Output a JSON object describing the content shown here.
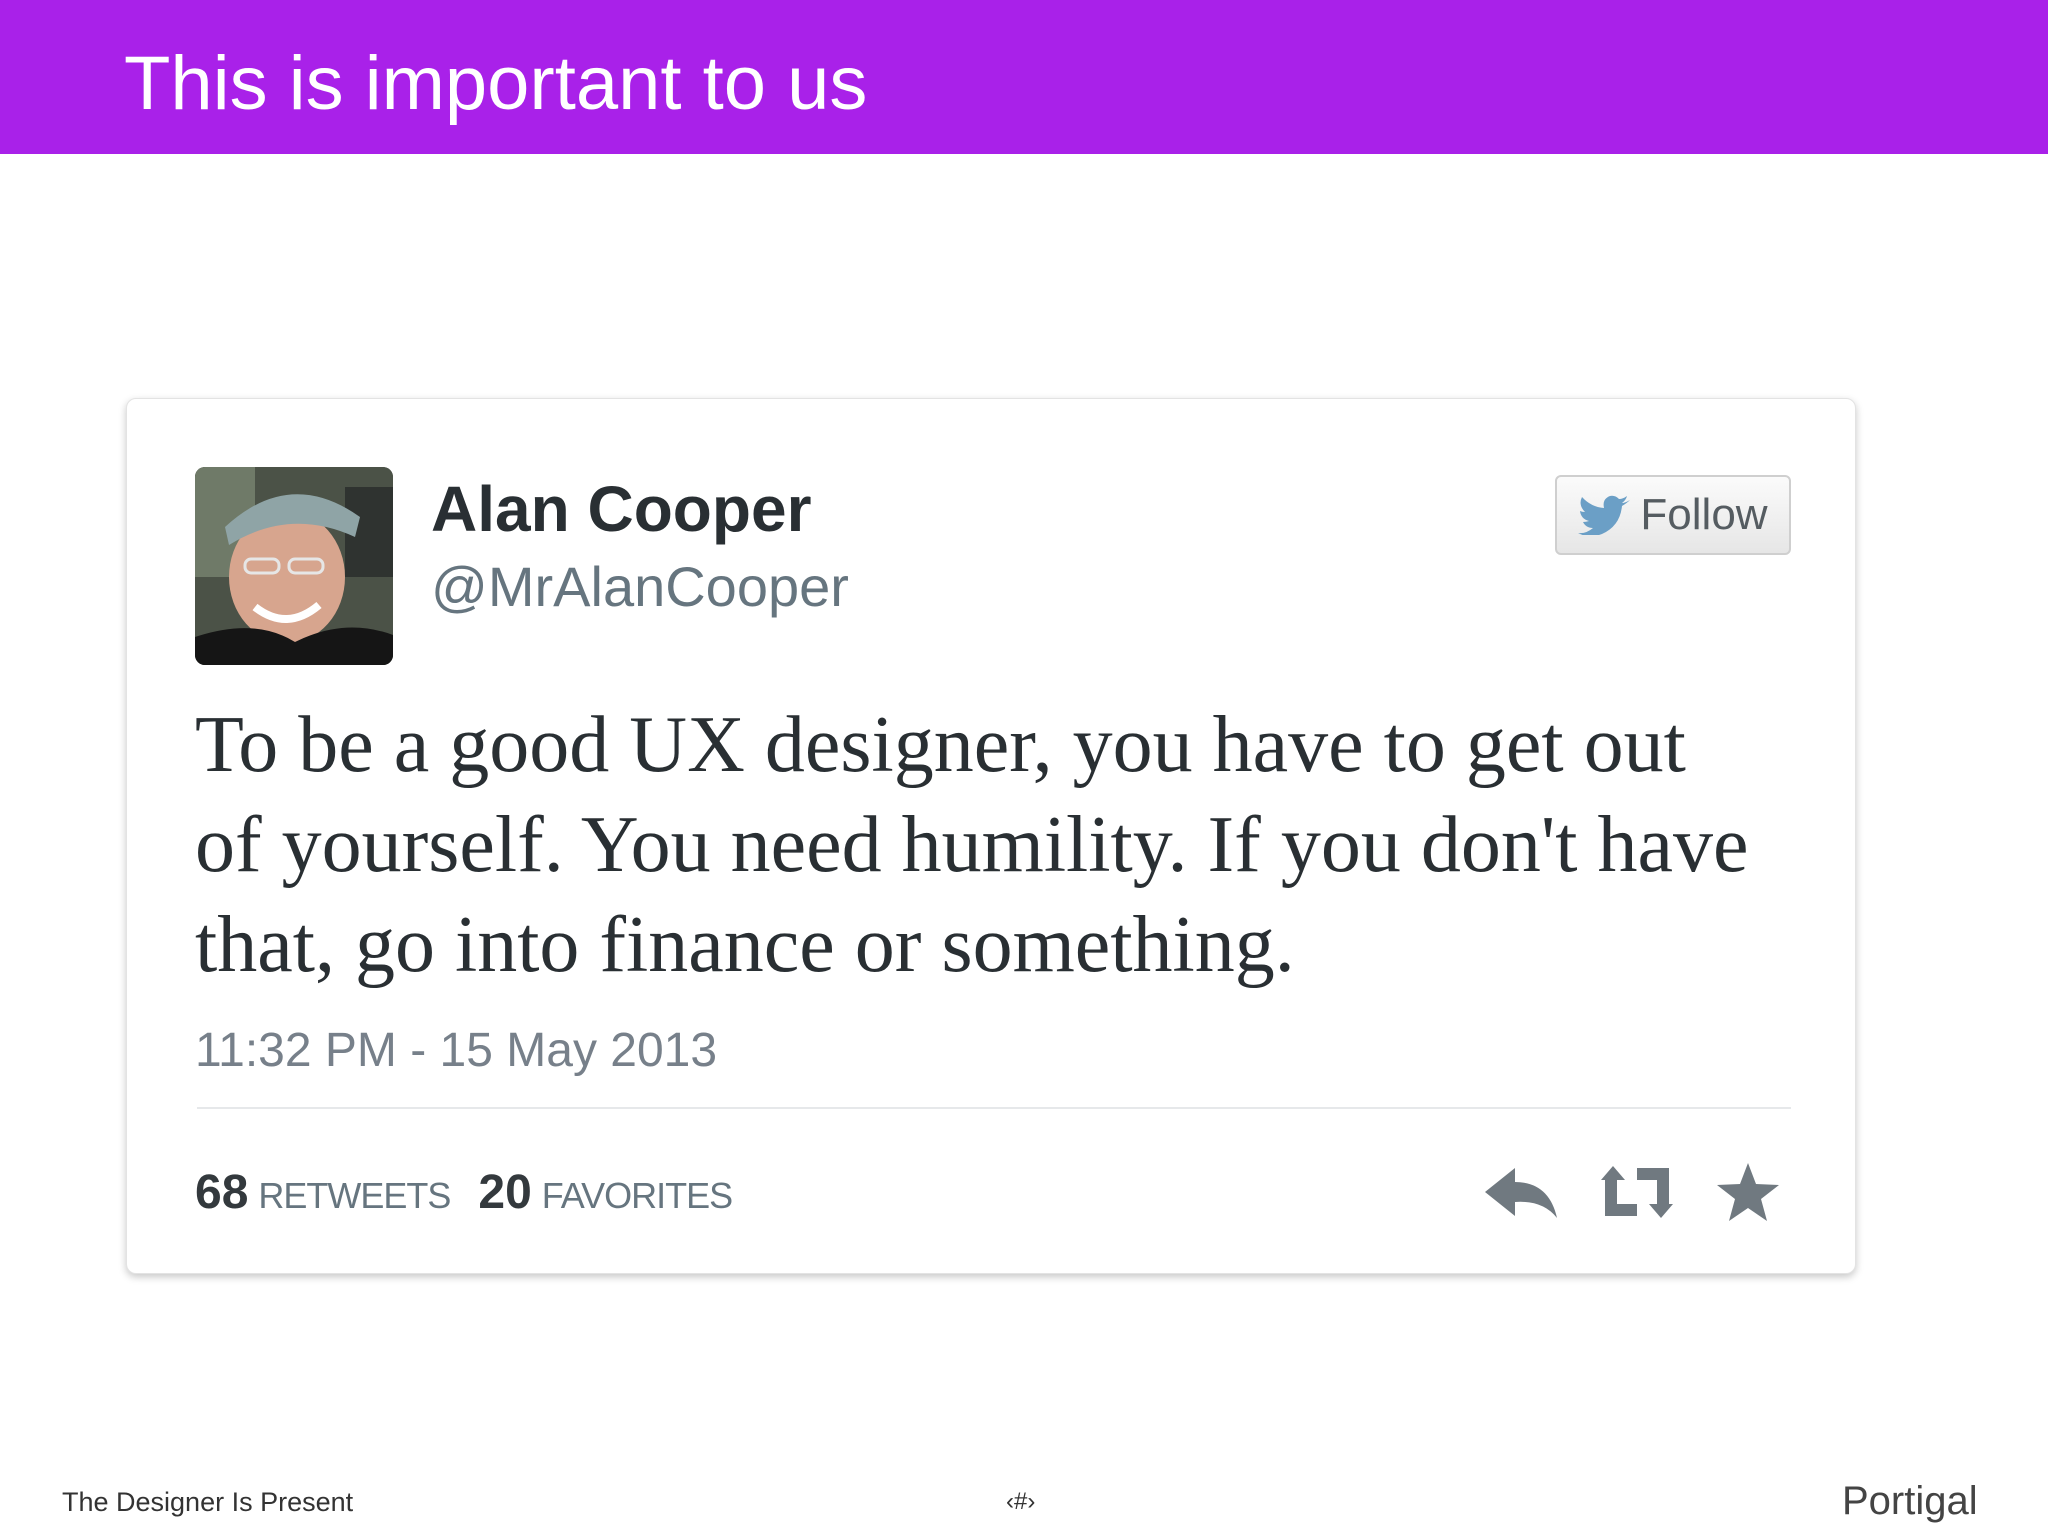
{
  "slide": {
    "title": "This is important to us",
    "header_color": "#a921e9"
  },
  "tweet": {
    "author_name": "Alan Cooper",
    "author_handle": "@MrAlanCooper",
    "follow_label": "Follow",
    "text": "To be a good UX designer, you have to get out of yourself. You need humility. If you don't have that, go into finance or something.",
    "timestamp": "11:32 PM - 15 May 2013",
    "retweets_count": "68",
    "retweets_label": "RETWEETS",
    "favorites_count": "20",
    "favorites_label": "FAVORITES",
    "icons": {
      "follow": "twitter-bird-icon",
      "reply": "reply-arrow-icon",
      "retweet": "retweet-icon",
      "favorite": "star-icon"
    }
  },
  "footer": {
    "left": "The Designer Is Present",
    "center": "‹#›",
    "right": "Portigal"
  }
}
